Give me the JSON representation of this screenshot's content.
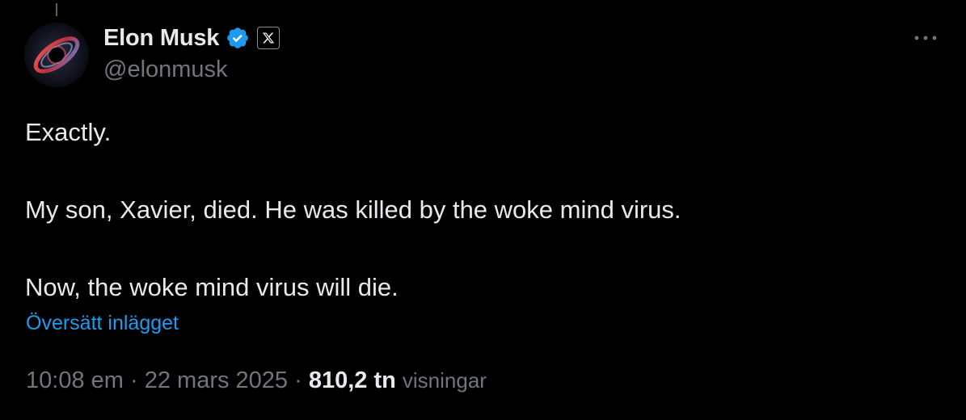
{
  "author": {
    "display_name": "Elon Musk",
    "handle": "@elonmusk",
    "verified": true,
    "affiliate_badge_icon": "x-logo-icon",
    "verified_color": "#1d9bf0"
  },
  "tweet": {
    "paragraphs": [
      "Exactly.",
      "My son, Xavier, died. He was killed by the woke mind virus.",
      "Now, the woke mind virus will die."
    ],
    "translate_label": "Översätt inlägget"
  },
  "meta": {
    "time": "10:08 em",
    "separator": "·",
    "date": "22 mars 2025",
    "views_count": "810,2 tn",
    "views_label": "visningar"
  },
  "colors": {
    "background": "#000000",
    "text": "#e7e9ea",
    "secondary_text": "#71767b",
    "link": "#1d9bf0"
  },
  "icons": {
    "more": "more-horizontal-icon",
    "verified": "verified-badge-icon"
  }
}
